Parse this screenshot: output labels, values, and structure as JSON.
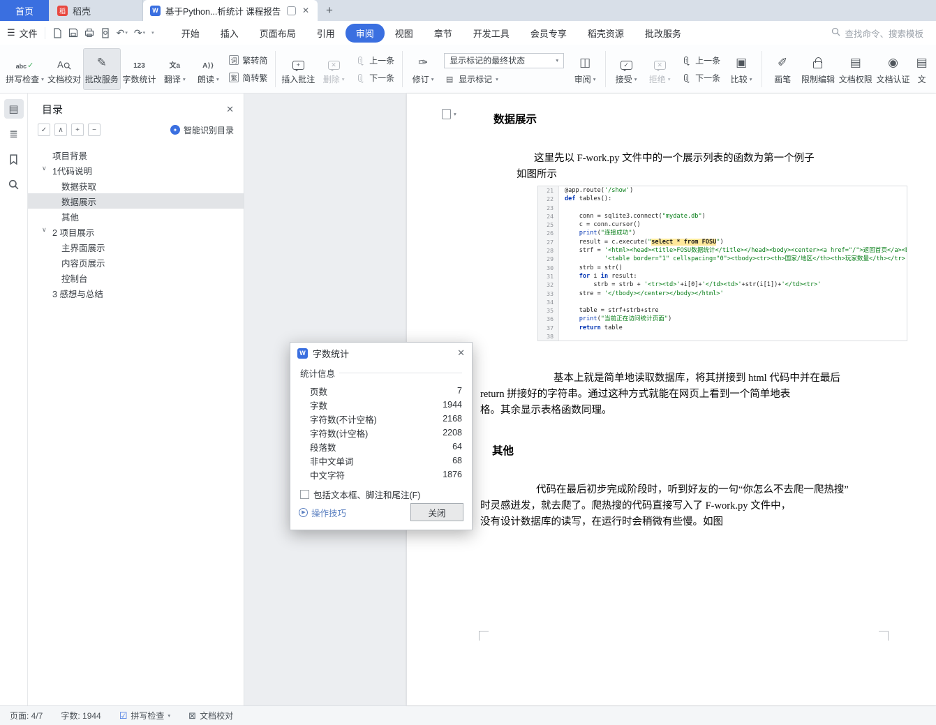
{
  "colors": {
    "accent": "#3a6fe0",
    "keyword_blue": "#0033b3",
    "string_green": "#067d17",
    "highlight_yellow": "#ffe89a"
  },
  "titlebar": {
    "home_tab": "首页",
    "docer_tab": "稻壳",
    "doc_tab_title": "基于Python...析统计 课程报告",
    "new_tab": "+"
  },
  "menubar": {
    "file_label": "文件",
    "items": [
      "开始",
      "插入",
      "页面布局",
      "引用",
      "审阅",
      "视图",
      "章节",
      "开发工具",
      "会员专享",
      "稻壳资源",
      "批改服务"
    ],
    "active": "审阅",
    "search_placeholder": "查找命令、搜索模板"
  },
  "ribbon": {
    "spellcheck": "拼写检查",
    "doc_proof": "文档校对",
    "correction": "批改服务",
    "word_count": "字数统计",
    "translate": "翻译",
    "read": "朗读",
    "t2s": "繁转简",
    "s2t": "简转繁",
    "t2s_tag": "词",
    "s2t_tag": "繁",
    "insert_comment": "插入批注",
    "del": "删除",
    "prev_comment": "上一条",
    "next_comment": "下一条",
    "markup_select": "显示标记的最终状态",
    "revision": "修订",
    "show_markup": "显示标记",
    "review": "审阅",
    "accept": "接受",
    "reject": "拒绝",
    "prev_change": "上一条",
    "next_change": "下一条",
    "compare": "比较",
    "pen": "画笔",
    "restrict": "限制编辑",
    "permission": "文档权限",
    "certify": "文档认证",
    "cutoff": "文"
  },
  "sidebar": {
    "title": "目录",
    "smart": "智能识别目录",
    "tree": [
      {
        "label": "项目背景",
        "indent": 1,
        "chevron": false,
        "selected": false
      },
      {
        "label": "1代码说明",
        "indent": 1,
        "chevron": true,
        "selected": false
      },
      {
        "label": "数据获取",
        "indent": 2,
        "chevron": false,
        "selected": false
      },
      {
        "label": "数据展示",
        "indent": 2,
        "chevron": false,
        "selected": true
      },
      {
        "label": "其他",
        "indent": 2,
        "chevron": false,
        "selected": false
      },
      {
        "label": "2 项目展示",
        "indent": 1,
        "chevron": true,
        "selected": false
      },
      {
        "label": "主界面展示",
        "indent": 2,
        "chevron": false,
        "selected": false
      },
      {
        "label": "内容页展示",
        "indent": 2,
        "chevron": false,
        "selected": false
      },
      {
        "label": "控制台",
        "indent": 2,
        "chevron": false,
        "selected": false
      },
      {
        "label": "3 感想与总结",
        "indent": 1,
        "chevron": false,
        "selected": false
      }
    ]
  },
  "document": {
    "heading1": "数据展示",
    "heading2": "其他",
    "para1": [
      {
        "text": "这里先以 F-work.py 文件中的一个展示列表的函数为第一个例子",
        "indent": true
      },
      {
        "text": "如图所示",
        "indent": false
      }
    ],
    "para2": [
      {
        "text": "基本上就是简单地读取数据库，将其拼接到 html 代码中并在最后",
        "indent": true
      },
      {
        "text": "return 拼接好的字符串。通过这种方式就能在网页上看到一个简单地表",
        "indent": false
      },
      {
        "text": "格。其余显示表格函数同理。",
        "indent": false
      }
    ],
    "para3": [
      {
        "text": "代码在最后初步完成阶段时，听到好友的一句“你怎么不去爬一爬热搜”",
        "indent": true
      },
      {
        "text": "时灵感迸发，就去爬了。爬热搜的代码直接写入了 F-work.py 文件中，",
        "indent": false
      },
      {
        "text": "没有设计数据库的读写，在运行时会稍微有些慢。如图",
        "indent": false
      }
    ],
    "code": {
      "lines": [
        {
          "n": 21,
          "segs": [
            [
              "d",
              "@app.route("
            ],
            [
              "s",
              "'/show'"
            ],
            [
              "d",
              ")"
            ]
          ]
        },
        {
          "n": 22,
          "segs": [
            [
              "k",
              "def "
            ],
            [
              "d",
              "tables():"
            ]
          ]
        },
        {
          "n": 23,
          "segs": []
        },
        {
          "n": 24,
          "segs": [
            [
              "d",
              "    conn = sqlite3.connect("
            ],
            [
              "s",
              "\"mydate.db\""
            ],
            [
              "d",
              ")"
            ]
          ]
        },
        {
          "n": 25,
          "segs": [
            [
              "d",
              "    c = conn.cursor()"
            ]
          ]
        },
        {
          "n": 26,
          "segs": [
            [
              "d",
              "    "
            ],
            [
              "fn",
              "print"
            ],
            [
              "d",
              "("
            ],
            [
              "s",
              "\"连接成功\""
            ],
            [
              "d",
              ")"
            ]
          ]
        },
        {
          "n": 27,
          "segs": [
            [
              "d",
              "    result = c.execute("
            ],
            [
              "s",
              "\""
            ],
            [
              "hl",
              "select * from FOSU"
            ],
            [
              "s",
              "\""
            ],
            [
              "d",
              ")"
            ]
          ]
        },
        {
          "n": 28,
          "segs": [
            [
              "d",
              "    strf = "
            ],
            [
              "s",
              "'<html><head><title>FOSU数据统计</title></head><body><center><a href=\"/\">返回首页</a><br>'"
            ],
            [
              "d",
              " \\"
            ]
          ]
        },
        {
          "n": 29,
          "segs": [
            [
              "s",
              "           '<table border=\"1\" cellspacing=\"0\"><tbody><tr><th>国家/地区</th><th>玩家数量</th></tr>'"
            ]
          ]
        },
        {
          "n": 30,
          "segs": [
            [
              "d",
              "    strb = str()"
            ]
          ]
        },
        {
          "n": 31,
          "segs": [
            [
              "k",
              "    for "
            ],
            [
              "d",
              "i "
            ],
            [
              "k",
              "in"
            ],
            [
              "d",
              " result:"
            ]
          ]
        },
        {
          "n": 32,
          "segs": [
            [
              "d",
              "        strb = strb + "
            ],
            [
              "s",
              "'<tr><td>'"
            ],
            [
              "d",
              "+i[0]+"
            ],
            [
              "s",
              "'</td><td>'"
            ],
            [
              "d",
              "+str(i[1])+"
            ],
            [
              "s",
              "'</td><tr>'"
            ]
          ]
        },
        {
          "n": 33,
          "segs": [
            [
              "d",
              "    stre = "
            ],
            [
              "s",
              "'</tbody></center></body></html>'"
            ]
          ]
        },
        {
          "n": 34,
          "segs": []
        },
        {
          "n": 35,
          "segs": [
            [
              "d",
              "    table = strf+strb+stre"
            ]
          ]
        },
        {
          "n": 36,
          "segs": [
            [
              "d",
              "    "
            ],
            [
              "fn",
              "print"
            ],
            [
              "d",
              "("
            ],
            [
              "s",
              "\"当前正在访问统计页面\""
            ],
            [
              "d",
              ")"
            ]
          ]
        },
        {
          "n": 37,
          "segs": [
            [
              "k",
              "    return"
            ],
            [
              "d",
              " table"
            ]
          ]
        },
        {
          "n": 38,
          "segs": []
        }
      ]
    }
  },
  "wordcount": {
    "title": "字数统计",
    "section": "统计信息",
    "rows": [
      {
        "label": "页数",
        "value": "7"
      },
      {
        "label": "字数",
        "value": "1944"
      },
      {
        "label": "字符数(不计空格)",
        "value": "2168"
      },
      {
        "label": "字符数(计空格)",
        "value": "2208"
      },
      {
        "label": "段落数",
        "value": "64"
      },
      {
        "label": "非中文单词",
        "value": "68"
      },
      {
        "label": "中文字符",
        "value": "1876"
      }
    ],
    "checkbox_label": "包括文本框、脚注和尾注(F)",
    "tips_link": "操作技巧",
    "close_button": "关闭"
  },
  "statusbar": {
    "page": "页面: 4/7",
    "words": "字数: 1944",
    "spellcheck": "拼写检查",
    "proofread": "文档校对"
  }
}
